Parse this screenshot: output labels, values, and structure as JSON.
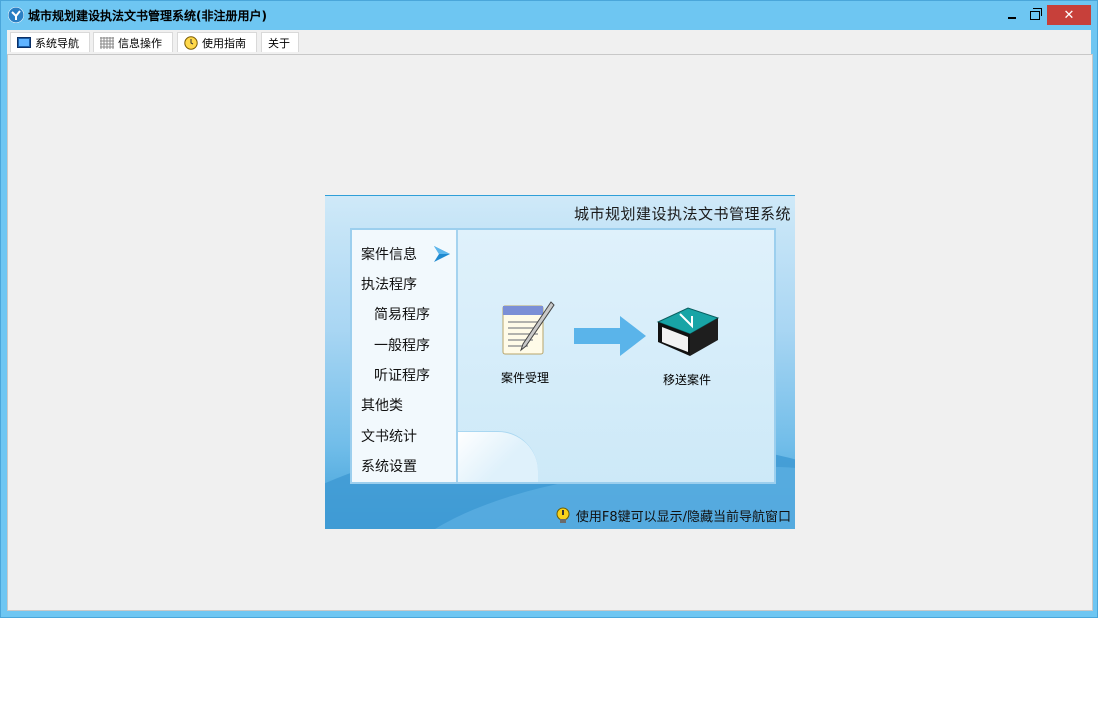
{
  "window": {
    "title": "城市规划建设执法文书管理系统(非注册用户)",
    "close_glyph": "✕"
  },
  "menu": [
    {
      "label": "系统导航",
      "icon": "monitor-icon"
    },
    {
      "label": "信息操作",
      "icon": "grid-icon"
    },
    {
      "label": "使用指南",
      "icon": "clock-icon"
    },
    {
      "label": "关于",
      "icon": ""
    }
  ],
  "panel": {
    "title": "城市规划建设执法文书管理系统",
    "nav": [
      {
        "label": "案件信息",
        "indent": false,
        "selected": true
      },
      {
        "label": "执法程序",
        "indent": false
      },
      {
        "label": "简易程序",
        "indent": true
      },
      {
        "label": "一般程序",
        "indent": true
      },
      {
        "label": "听证程序",
        "indent": true
      },
      {
        "label": "其他类",
        "indent": false
      },
      {
        "label": "文书统计",
        "indent": false
      },
      {
        "label": "系统设置",
        "indent": false
      }
    ],
    "flow": [
      {
        "label": "案件受理",
        "icon": "document-pen-icon"
      },
      {
        "label": "移送案件",
        "icon": "book-icon"
      }
    ],
    "hint": "使用F8键可以显示/隐藏当前导航窗口"
  },
  "colors": {
    "titlebar": "#6ec6f2",
    "close": "#c7403a",
    "accent": "#1f8ad0"
  }
}
